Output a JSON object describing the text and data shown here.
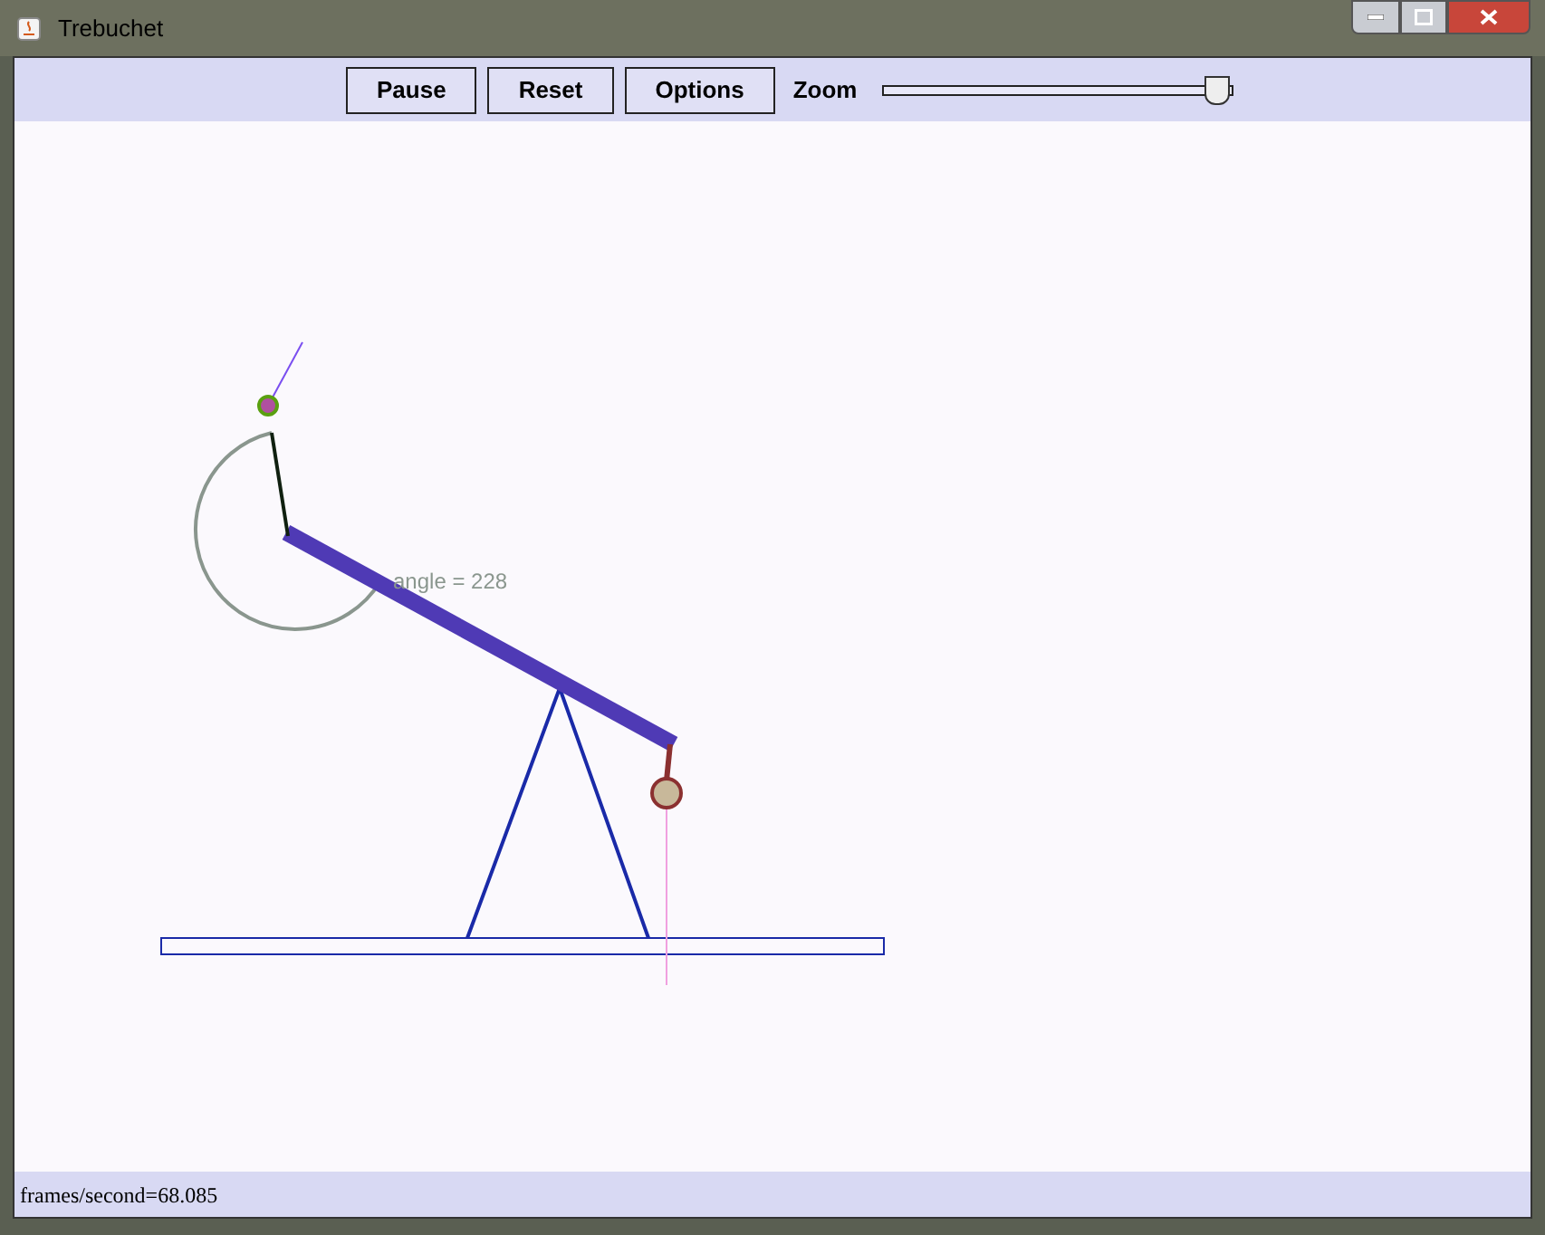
{
  "window": {
    "title": "Trebuchet"
  },
  "toolbar": {
    "buttons": [
      "Pause",
      "Reset",
      "Options"
    ],
    "zoom_label": "Zoom",
    "zoom": {
      "level": 0.95
    }
  },
  "canvas": {
    "angle_label": "angle = 228"
  },
  "status_bar": {
    "text": "frames/second=68.085"
  }
}
